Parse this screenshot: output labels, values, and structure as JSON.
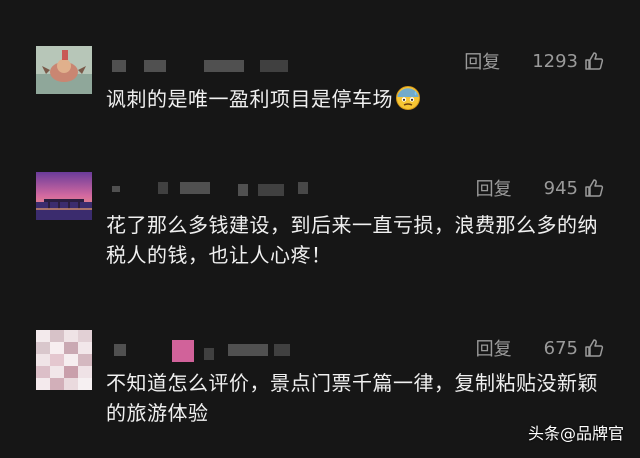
{
  "comments": [
    {
      "avatar": "avatar-photo",
      "reply_label": "回复",
      "likes": "1293",
      "text": "讽刺的是唯一盈利项目是停车场",
      "emoji": "anxious-sweat-emoji"
    },
    {
      "avatar": "avatar-sunset",
      "reply_label": "回复",
      "likes": "945",
      "text": "花了那么多钱建设，到后来一直亏损，浪费那么多的纳税人的钱，也让人心疼！"
    },
    {
      "avatar": "avatar-mosaic",
      "reply_label": "回复",
      "likes": "675",
      "text": "不知道怎么评价，景点门票千篇一律，复制粘贴没新颖的旅游体验"
    }
  ],
  "watermark": {
    "prefix": "头条",
    "handle": "@品牌官"
  },
  "colors": {
    "background": "#161616",
    "text": "#f0f0f0",
    "meta": "#9a9a9a"
  }
}
